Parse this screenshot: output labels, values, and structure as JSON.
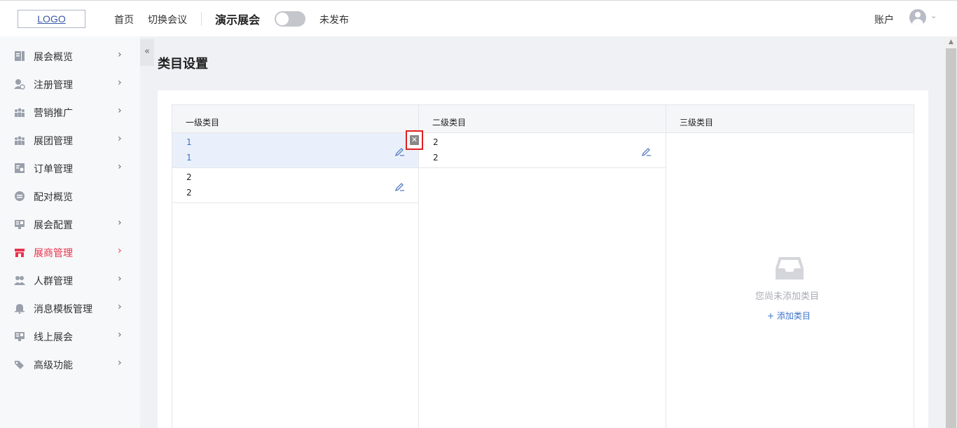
{
  "header": {
    "logo": "LOGO",
    "nav": [
      "首页",
      "切换会议"
    ],
    "expo_name": "演示展会",
    "publish_status": "未发布",
    "account": "账户"
  },
  "sidebar": {
    "items": [
      {
        "label": "展会概览",
        "icon": "overview-icon",
        "chevron": "›"
      },
      {
        "label": "注册管理",
        "icon": "user-register-icon",
        "chevron": "›"
      },
      {
        "label": "营销推广",
        "icon": "marketing-icon",
        "chevron": "›"
      },
      {
        "label": "展团管理",
        "icon": "group-icon",
        "chevron": "›"
      },
      {
        "label": "订单管理",
        "icon": "order-icon",
        "chevron": "›"
      },
      {
        "label": "配对概览",
        "icon": "match-icon",
        "chevron": ""
      },
      {
        "label": "展会配置",
        "icon": "config-icon",
        "chevron": "›"
      },
      {
        "label": "展商管理",
        "icon": "store-icon",
        "chevron": "›",
        "active": true
      },
      {
        "label": "人群管理",
        "icon": "crowd-icon",
        "chevron": "›"
      },
      {
        "label": "消息模板管理",
        "icon": "bell-icon",
        "chevron": "›"
      },
      {
        "label": "线上展会",
        "icon": "online-icon",
        "chevron": "›"
      },
      {
        "label": "高级功能",
        "icon": "tag-icon",
        "chevron": "›"
      }
    ],
    "collapse": "«"
  },
  "main": {
    "title": "类目设置",
    "columns": [
      {
        "head": "一级类目",
        "rows": [
          {
            "l1": "1",
            "l2": "1",
            "selected": true
          },
          {
            "l1": "2",
            "l2": "2"
          }
        ]
      },
      {
        "head": "二级类目",
        "rows": [
          {
            "l1": "2",
            "l2": "2"
          }
        ]
      },
      {
        "head": "三级类目",
        "rows": []
      }
    ],
    "close_glyph": "✕",
    "empty_text": "您尚未添加类目",
    "add_category": "+ 添加类目"
  },
  "colors": {
    "accent": "#3a72c8",
    "active": "#e8344c",
    "highlight": "#e02020"
  }
}
